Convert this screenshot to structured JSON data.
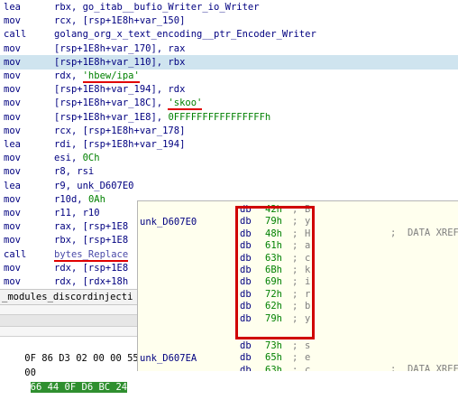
{
  "listing": {
    "rows": [
      {
        "mnemonic": "lea",
        "operand": "rbx, go_itab__bufio_Writer_io_Writer",
        "highlight": false
      },
      {
        "mnemonic": "mov",
        "operand": "rcx, [rsp+1E8h+var_150]",
        "highlight": false
      },
      {
        "mnemonic": "call",
        "operand": "golang_org_x_text_encoding__ptr_Encoder_Writer",
        "highlight": false
      },
      {
        "mnemonic": "mov",
        "operand": "[rsp+1E8h+var_170], rax",
        "highlight": false
      },
      {
        "mnemonic": "mov",
        "operand": "[rsp+1E8h+var_110], rbx",
        "highlight": true
      },
      {
        "mnemonic": "mov",
        "operand_pre": "rdx, ",
        "string": "'hbew/ipa'",
        "highlight": false
      },
      {
        "mnemonic": "mov",
        "operand": "[rsp+1E8h+var_194], rdx",
        "highlight": false
      },
      {
        "mnemonic": "mov",
        "operand_pre": "[rsp+1E8h+var_18C], ",
        "string": "'skoo'",
        "highlight": false
      },
      {
        "mnemonic": "mov",
        "operand_pre": "[rsp+1E8h+var_1E8], ",
        "number": "0FFFFFFFFFFFFFFFFh",
        "highlight": false
      },
      {
        "mnemonic": "mov",
        "operand": "rcx, [rsp+1E8h+var_178]",
        "highlight": false
      },
      {
        "mnemonic": "lea",
        "operand": "rdi, [rsp+1E8h+var_194]",
        "highlight": false
      },
      {
        "mnemonic": "mov",
        "operand_pre": "esi, ",
        "number": "0Ch",
        "highlight": false
      },
      {
        "mnemonic": "mov",
        "operand": "r8, rsi",
        "highlight": false
      },
      {
        "mnemonic": "lea",
        "operand": "r9, unk_D607E0",
        "highlight": false
      },
      {
        "mnemonic": "mov",
        "operand_pre": "r10d, ",
        "number": "0Ah",
        "highlight": false
      },
      {
        "mnemonic": "mov",
        "operand": "r11, r10",
        "highlight": false
      },
      {
        "mnemonic": "mov",
        "operand": "rax, [rsp+1E8",
        "highlight": false
      },
      {
        "mnemonic": "mov",
        "operand": "rbx, [rsp+1E8",
        "highlight": false
      },
      {
        "mnemonic": "call",
        "call_name": "bytes_Replace",
        "highlight": false
      },
      {
        "mnemonic": "mov",
        "operand": "rdx, [rsp+1E8",
        "highlight": false
      },
      {
        "mnemonic": "mov",
        "operand": "rdx, [rdx+18h",
        "highlight": false
      }
    ]
  },
  "lower": {
    "function_bar": "_modules_discordinjecti",
    "hex_rows": [
      {
        "addr": "0F 86 D3 02 00 00 55"
      },
      {
        "addr": "00",
        "selected": "66 44 0F D6 BC 24"
      }
    ]
  },
  "popup": {
    "label1": "unk_D607E0",
    "label2": "unk_D607EA",
    "xref": ";  DATA XREF",
    "directive": "db",
    "comment": ";",
    "block1": [
      {
        "value": "42h",
        "char": "B"
      },
      {
        "value": "79h",
        "char": "y"
      },
      {
        "value": "48h",
        "char": "H"
      },
      {
        "value": "61h",
        "char": "a"
      },
      {
        "value": "63h",
        "char": "c"
      },
      {
        "value": "6Bh",
        "char": "k"
      },
      {
        "value": "69h",
        "char": "i"
      },
      {
        "value": "72h",
        "char": "r"
      },
      {
        "value": "62h",
        "char": "b"
      },
      {
        "value": "79h",
        "char": "y"
      }
    ],
    "block2": [
      {
        "value": "73h",
        "char": "s"
      },
      {
        "value": "65h",
        "char": "e"
      },
      {
        "value": "63h",
        "char": "c"
      }
    ]
  },
  "colors": {
    "highlight_row": "#cfe4ef",
    "underline": "#e00000",
    "popup_bg": "#ffffee",
    "hex_selected": "#2f8f2f"
  }
}
